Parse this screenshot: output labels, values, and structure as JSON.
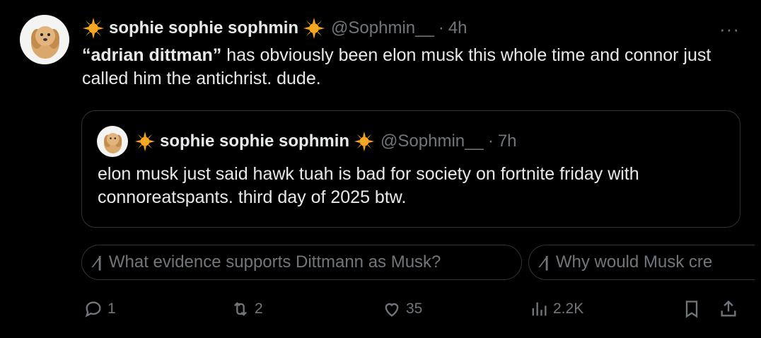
{
  "post": {
    "display_name": "sophie sophie sophmin",
    "handle": "@Sophmin__",
    "separator": "·",
    "time": "4h",
    "more_label": "···",
    "text_bold": "“adrian dittman”",
    "text_rest": " has obviously been elon musk this whole time and connor just called him the antichrist. dude."
  },
  "quote": {
    "display_name": "sophie sophie sophmin",
    "handle": "@Sophmin__",
    "separator": "·",
    "time": "7h",
    "text": "elon musk just said hawk tuah is bad for society on fortnite friday with connoreatspants. third day of 2025 btw."
  },
  "grok_suggestions": [
    {
      "label": "What evidence supports Dittmann as Musk?"
    },
    {
      "label": "Why would Musk cre"
    }
  ],
  "actions": {
    "replies": "1",
    "reposts": "2",
    "likes": "35",
    "views": "2.2K"
  },
  "colors": {
    "background": "#000000",
    "text": "#e7e9ea",
    "muted": "#71767b",
    "border": "#2f3336",
    "sun_emoji": "#f5a623"
  },
  "icons": [
    "sun-emoji-icon",
    "more-icon",
    "grok-icon",
    "reply-icon",
    "repost-icon",
    "like-icon",
    "views-icon",
    "bookmark-icon",
    "share-icon"
  ]
}
